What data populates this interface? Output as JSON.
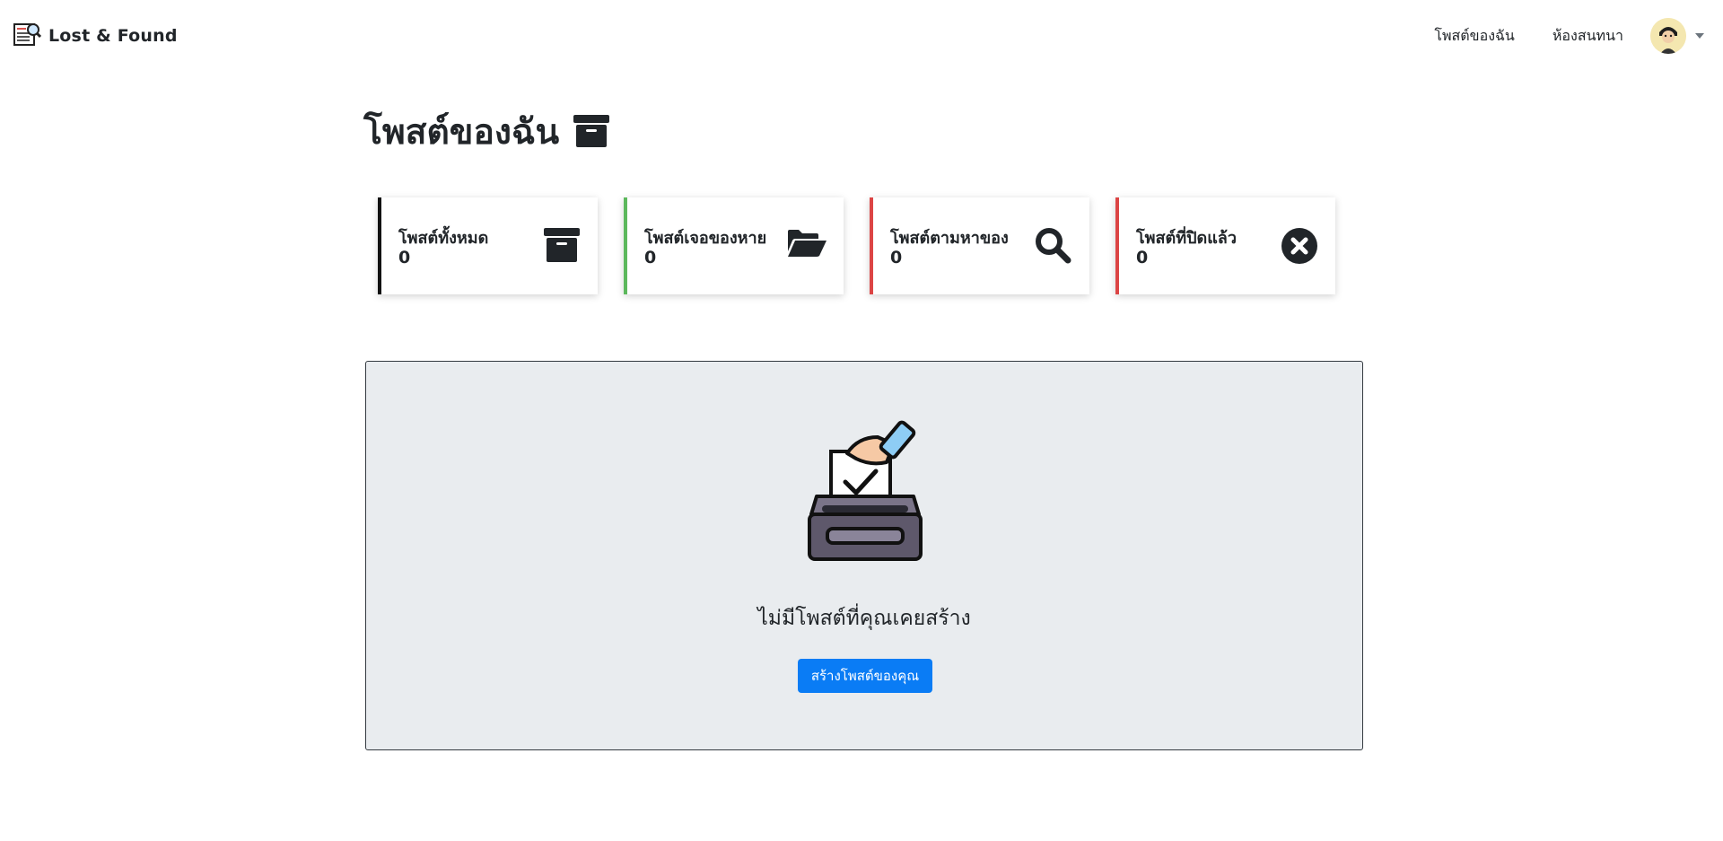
{
  "brand": {
    "name": "Lost & Found",
    "icon": "newspaper-search-icon"
  },
  "nav": {
    "my_posts": "โพสต์ของฉัน",
    "chat_room": "ห้องสนทนา",
    "avatar_icon": "user-avatar"
  },
  "page": {
    "title": "โพสต์ของฉัน",
    "title_icon": "archive-icon"
  },
  "stats": [
    {
      "label": "โพสต์ทั้งหมด",
      "value": "0",
      "accent": "#111111",
      "icon": "archive-icon"
    },
    {
      "label": "โพสต์เจอของหาย",
      "value": "0",
      "accent": "#5cb85c",
      "icon": "folder-open-icon"
    },
    {
      "label": "โพสต์ตามหาของ",
      "value": "0",
      "accent": "#dc4545",
      "icon": "search-icon"
    },
    {
      "label": "โพสต์ที่ปิดแล้ว",
      "value": "0",
      "accent": "#dc4545",
      "icon": "times-circle-icon"
    }
  ],
  "empty": {
    "message": "ไม่มีโพสต์ที่คุณเคยสร้าง",
    "button": "สร้างโพสต์ของคุณ",
    "illustration": "ballot-box-icon",
    "button_color": "#0a7cf5"
  }
}
